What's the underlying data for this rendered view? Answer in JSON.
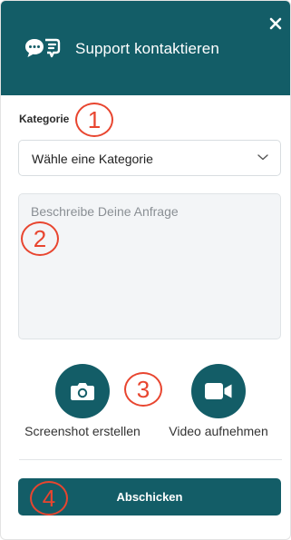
{
  "header": {
    "title": "Support kontaktieren",
    "icon": "chat-support-icon",
    "close_icon": "close-icon",
    "background_color": "#135d67"
  },
  "form": {
    "category_label": "Kategorie",
    "category_select": {
      "selected": "Wähle eine Kategorie",
      "icon": "chevron-down-icon"
    },
    "description": {
      "placeholder": "Beschreibe Deine Anfrage",
      "value": ""
    }
  },
  "actions": {
    "screenshot": {
      "label": "Screenshot erstellen",
      "icon": "camera-icon"
    },
    "video": {
      "label": "Video aufnehmen",
      "icon": "video-camera-icon"
    }
  },
  "submit_label": "Abschicken",
  "annotations": [
    {
      "number": "1",
      "color": "#e8452f"
    },
    {
      "number": "2",
      "color": "#e8452f"
    },
    {
      "number": "3",
      "color": "#e8452f"
    },
    {
      "number": "4",
      "color": "#e8452f"
    }
  ],
  "colors": {
    "accent": "#135d67",
    "annotation": "#e8452f"
  }
}
